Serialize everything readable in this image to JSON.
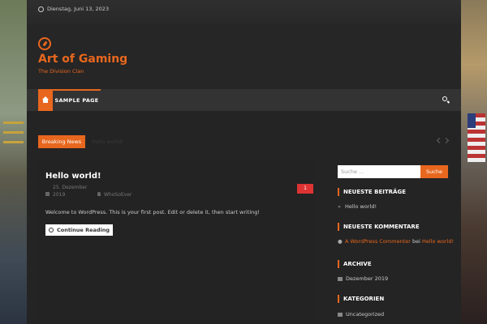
{
  "topbar": {
    "date": "Dienstag, Juni 13, 2023"
  },
  "header": {
    "site_title": "Art of Gaming",
    "tagline": "The Division Clan"
  },
  "nav": {
    "items": [
      {
        "label": "SAMPLE PAGE"
      }
    ]
  },
  "ticker": {
    "label": "Breaking News",
    "item": "Hello world!"
  },
  "post": {
    "title": "Hello world!",
    "date_day_month": "25. Dezember",
    "date_year": "2019",
    "author": "WhoSoEver",
    "comment_count": "1",
    "excerpt": "Welcome to WordPress. This is your first post. Edit or delete it, then start writing!",
    "continue_label": "Continue Reading"
  },
  "sidebar": {
    "search_placeholder": "Suche …",
    "search_button": "Suche",
    "recent_posts_title": "NEUESTE BEITRÄGE",
    "recent_posts": [
      "Hello world!"
    ],
    "recent_comments_title": "NEUESTE KOMMENTARE",
    "recent_comment": {
      "author": "A WordPress Commenter",
      "on": "bei",
      "post": "Hello world!"
    },
    "archive_title": "ARCHIVE",
    "archives": [
      "Dezember 2019"
    ],
    "categories_title": "KATEGORIEN",
    "categories": [
      "Uncategorized"
    ]
  },
  "colors": {
    "accent": "#e8671e",
    "background": "#242424"
  }
}
